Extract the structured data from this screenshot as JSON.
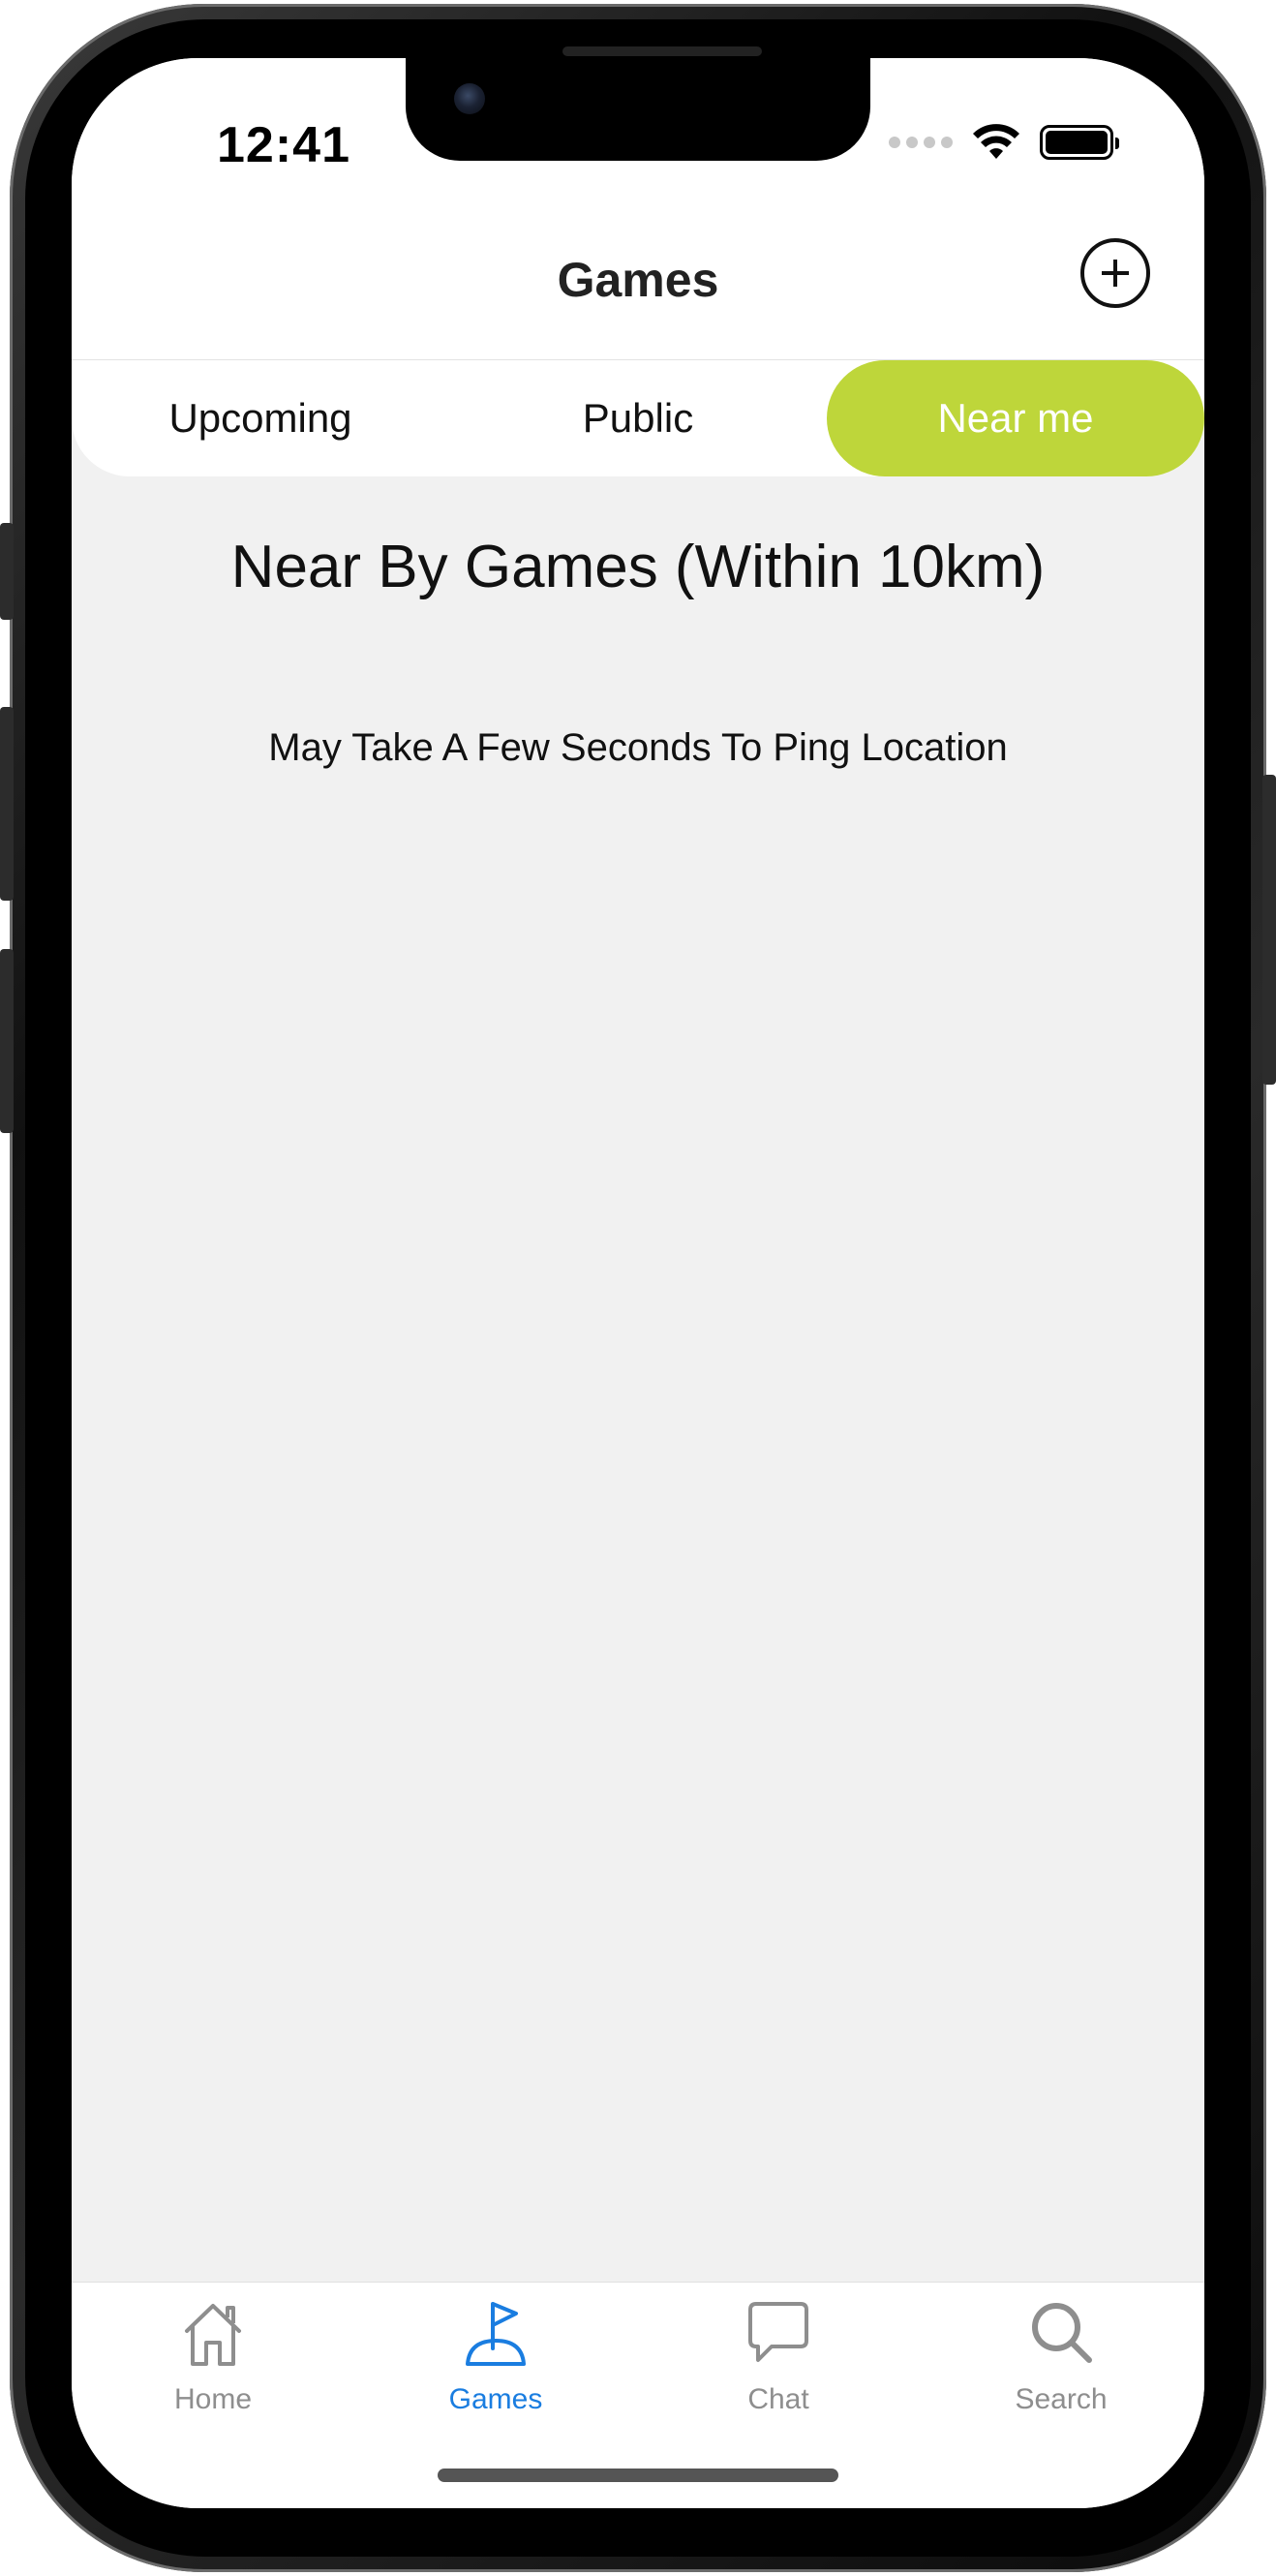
{
  "status_bar": {
    "time": "12:41"
  },
  "header": {
    "title": "Games",
    "add_icon": "plus-circle-icon"
  },
  "segments": {
    "items": [
      {
        "label": "Upcoming",
        "active": false
      },
      {
        "label": "Public",
        "active": false
      },
      {
        "label": "Near me",
        "active": true
      }
    ],
    "active_color": "#bed63a"
  },
  "content": {
    "title": "Near By Games (Within 10km)",
    "subtitle": "May Take A Few Seconds To Ping Location"
  },
  "tab_bar": {
    "items": [
      {
        "label": "Home",
        "icon": "house-icon",
        "active": false
      },
      {
        "label": "Games",
        "icon": "golf-flag-icon",
        "active": true
      },
      {
        "label": "Chat",
        "icon": "chat-bubble-icon",
        "active": false
      },
      {
        "label": "Search",
        "icon": "magnifier-icon",
        "active": false
      }
    ],
    "active_color": "#1a7de0",
    "inactive_color": "#8e8e8e"
  }
}
